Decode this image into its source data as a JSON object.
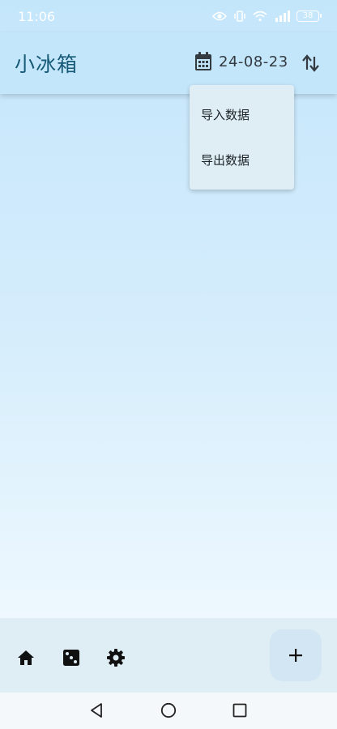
{
  "status_bar": {
    "time": "11:06",
    "battery": "38",
    "icons": [
      "eye-icon",
      "vibrate-icon",
      "wifi-icon",
      "signal-icon",
      "battery-icon"
    ]
  },
  "app_bar": {
    "title": "小冰箱",
    "date": "24-08-23",
    "icons": [
      "calendar-icon",
      "sort-icon"
    ]
  },
  "menu": {
    "items": [
      {
        "label": "导入数据"
      },
      {
        "label": "导出数据"
      }
    ]
  },
  "bottom_bar": {
    "icons": [
      "home-icon",
      "dice-icon",
      "gear-icon",
      "plus-icon"
    ]
  },
  "system_nav": {
    "icons": [
      "back-icon",
      "home-circle-icon",
      "recents-icon"
    ]
  },
  "colors": {
    "title": "#165a78",
    "app_bar_bg": "#c4e6fb",
    "menu_bg": "#dfeef5",
    "bottom_bar_bg": "#dfeef5",
    "fab_bg": "#d2e6f3"
  }
}
